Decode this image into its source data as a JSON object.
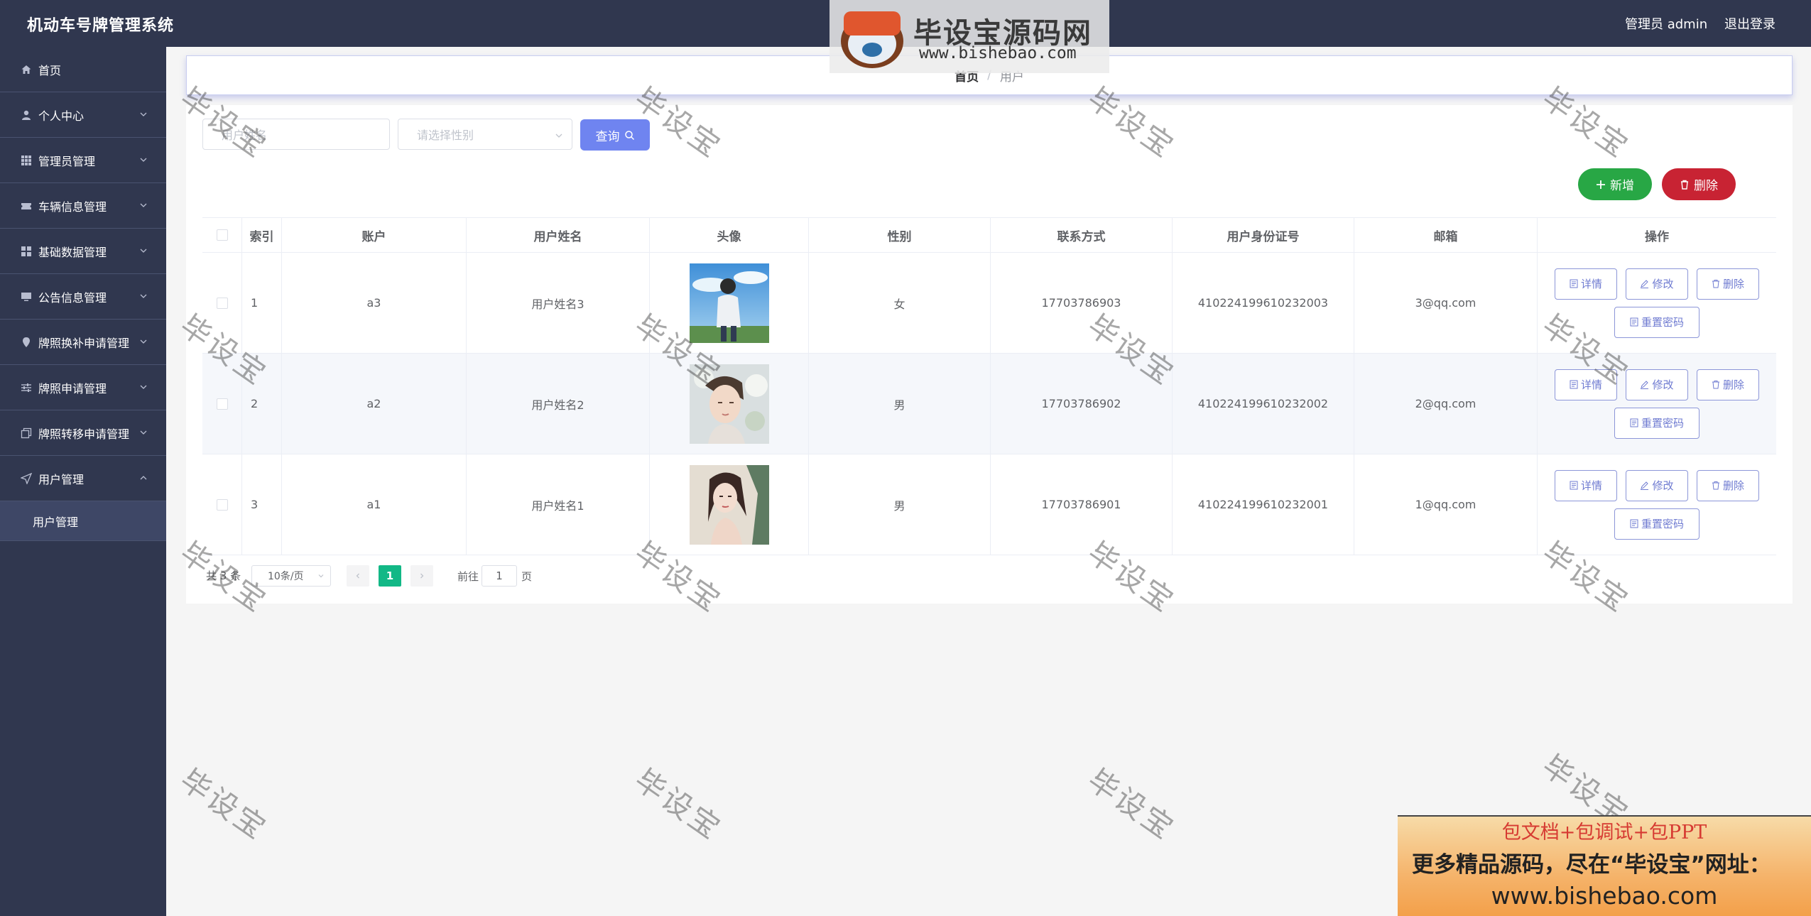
{
  "app": {
    "title": "机动车号牌管理系统",
    "admin_label": "管理员 admin",
    "logout_label": "退出登录"
  },
  "sidebar": {
    "items": [
      {
        "label": "首页",
        "icon": "home-icon"
      },
      {
        "label": "个人中心",
        "icon": "user-icon"
      },
      {
        "label": "管理员管理",
        "icon": "grid-icon"
      },
      {
        "label": "车辆信息管理",
        "icon": "ticket-icon"
      },
      {
        "label": "基础数据管理",
        "icon": "menu-icon"
      },
      {
        "label": "公告信息管理",
        "icon": "monitor-icon"
      },
      {
        "label": "牌照换补申请管理",
        "icon": "location-icon"
      },
      {
        "label": "牌照申请管理",
        "icon": "sliders-icon"
      },
      {
        "label": "牌照转移申请管理",
        "icon": "copy-icon"
      },
      {
        "label": "用户管理",
        "icon": "send-icon"
      }
    ],
    "active_sub": "用户管理"
  },
  "breadcrumb": {
    "home": "首页",
    "current": "用户"
  },
  "search": {
    "name_placeholder": "用户姓名",
    "gender_placeholder": "请选择性别",
    "query_label": "查询"
  },
  "actions": {
    "add_label": "新增",
    "delete_label": "删除"
  },
  "table": {
    "headers": [
      "索引",
      "账户",
      "用户姓名",
      "头像",
      "性别",
      "联系方式",
      "用户身份证号",
      "邮箱",
      "操作"
    ],
    "rows": [
      {
        "index": "1",
        "account": "a3",
        "name": "用户姓名3",
        "gender": "女",
        "phone": "17703786903",
        "id_no": "410224199610232003",
        "email": "3@qq.com"
      },
      {
        "index": "2",
        "account": "a2",
        "name": "用户姓名2",
        "gender": "男",
        "phone": "17703786902",
        "id_no": "410224199610232002",
        "email": "2@qq.com"
      },
      {
        "index": "3",
        "account": "a1",
        "name": "用户姓名1",
        "gender": "男",
        "phone": "17703786901",
        "id_no": "410224199610232001",
        "email": "1@qq.com"
      }
    ],
    "op_labels": {
      "detail": "详情",
      "edit": "修改",
      "delete": "删除",
      "reset": "重置密码"
    }
  },
  "pagination": {
    "total": "共 3 条",
    "page_size": "10条/页",
    "current_page": "1",
    "goto_label": "前往",
    "goto_value": "1",
    "page_unit": "页"
  },
  "watermark": {
    "text": "毕设宝",
    "logo_text": "毕设宝源码网",
    "logo_url": "www.bishebao.com"
  },
  "ad": {
    "line1": "包文档+包调试+包PPT",
    "line2": "更多精品源码，尽在“毕设宝”网址：",
    "line3": "www.bishebao.com"
  },
  "colors": {
    "sidebar": "#30374f",
    "primary": "#6f7bd1",
    "success": "#28a745",
    "danger": "#c82333",
    "page_active": "#12b886"
  }
}
